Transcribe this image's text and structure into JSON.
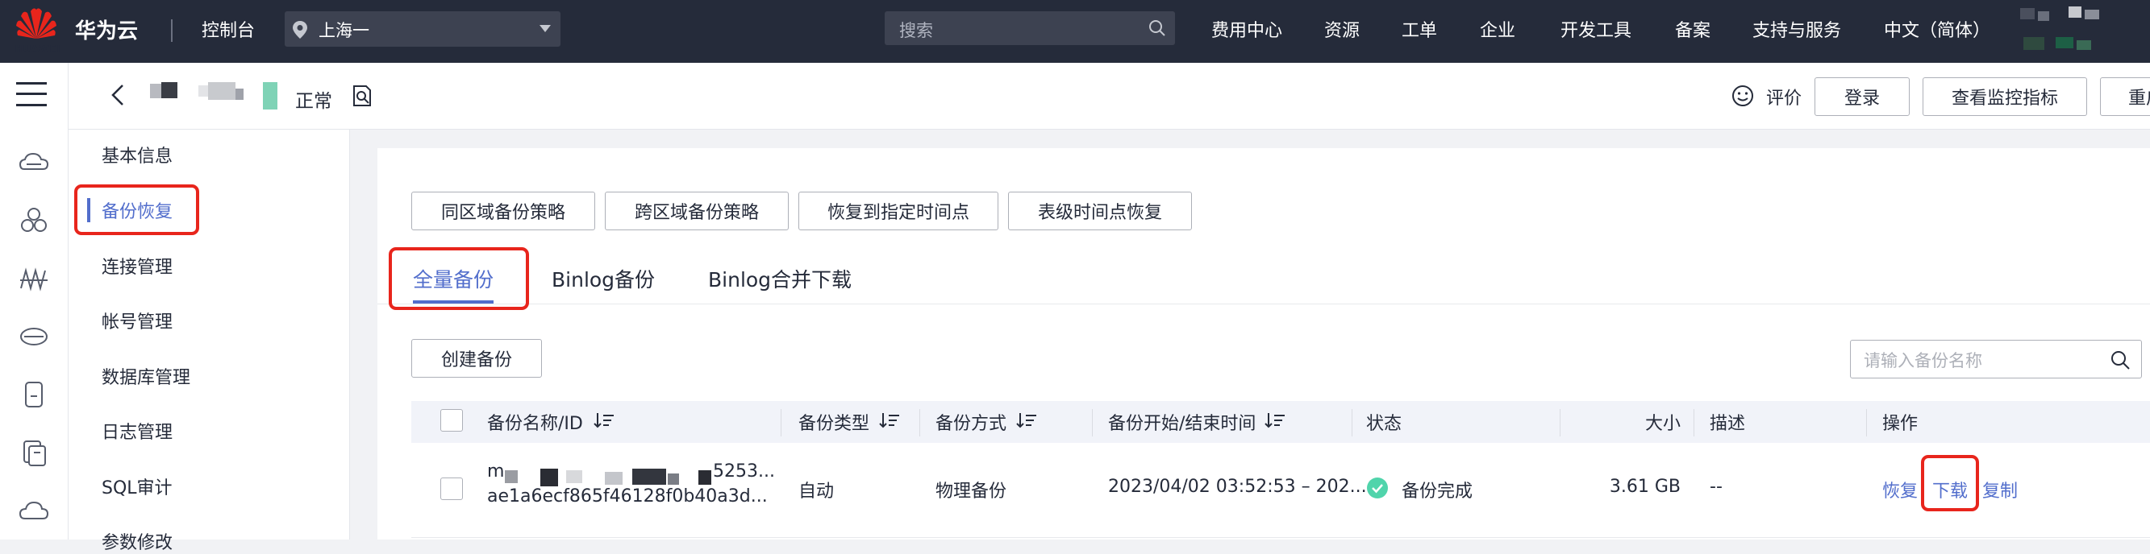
{
  "topbar": {
    "logo_text": "HUAWEI",
    "brand": "华为云",
    "console": "控制台",
    "region": "上海一",
    "search_placeholder": "搜索",
    "nav": [
      "费用中心",
      "资源",
      "工单",
      "企业",
      "开发工具",
      "备案",
      "支持与服务",
      "中文（简体）"
    ]
  },
  "subheader": {
    "status": "正常",
    "rate_label": "评价",
    "buttons": [
      "登录",
      "查看监控指标",
      "重启"
    ]
  },
  "subnav": {
    "items": [
      "基本信息",
      "备份恢复",
      "连接管理",
      "帐号管理",
      "数据库管理",
      "日志管理",
      "SQL审计",
      "参数修改"
    ],
    "active_index": 1
  },
  "actions": {
    "buttons": [
      "同区域备份策略",
      "跨区域备份策略",
      "恢复到指定时间点",
      "表级时间点恢复"
    ]
  },
  "tabs": {
    "items": [
      "全量备份",
      "Binlog备份",
      "Binlog合并下载"
    ],
    "active_index": 0
  },
  "toolbar": {
    "create_label": "创建备份",
    "search_placeholder": "请输入备份名称"
  },
  "table": {
    "headers": [
      "备份名称/ID",
      "备份类型",
      "备份方式",
      "备份开始/结束时间",
      "状态",
      "大小",
      "描述",
      "操作"
    ],
    "rows": [
      {
        "name_prefix": "m",
        "name_suffix": "5253...",
        "id": "ae1a6ecf865f46128f0b40a3d...",
        "type": "自动",
        "method": "物理备份",
        "time": "2023/04/02 03:52:53 – 202...",
        "status": "备份完成",
        "size": "3.61 GB",
        "desc": "--",
        "ops": [
          "恢复",
          "下载",
          "复制"
        ]
      }
    ]
  },
  "colors": {
    "topbar_bg": "#252b3a",
    "accent": "#526ecc",
    "highlight_red": "#e8251c",
    "success_green": "#50d4ab"
  }
}
